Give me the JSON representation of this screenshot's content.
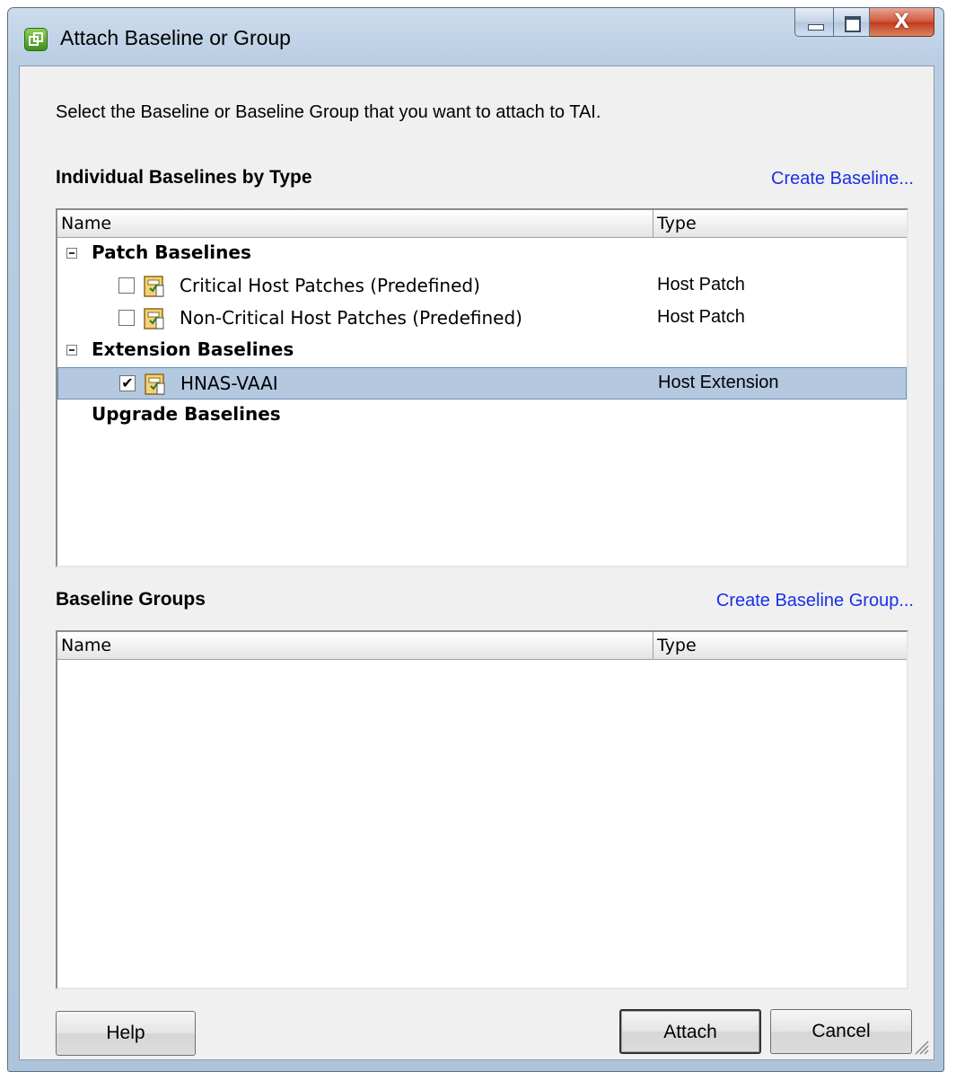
{
  "window": {
    "title": "Attach Baseline or Group",
    "close_glyph": "X"
  },
  "instruction": "Select the Baseline or Baseline Group that you want to attach to TAI.",
  "individual": {
    "heading": "Individual Baselines by Type",
    "create_link": "Create Baseline...",
    "columns": {
      "name": "Name",
      "type": "Type"
    },
    "groups": [
      {
        "label": "Patch Baselines",
        "expanded": true,
        "items": [
          {
            "name": "Critical Host Patches (Predefined)",
            "type": "Host Patch",
            "checked": false
          },
          {
            "name": "Non-Critical Host Patches (Predefined)",
            "type": "Host Patch",
            "checked": false
          }
        ]
      },
      {
        "label": "Extension Baselines",
        "expanded": true,
        "items": [
          {
            "name": "HNAS-VAAI",
            "type": "Host Extension",
            "checked": true,
            "selected": true
          }
        ]
      },
      {
        "label": "Upgrade Baselines",
        "expanded": false,
        "items": []
      }
    ],
    "check_mark": "✔"
  },
  "groups_section": {
    "heading": "Baseline Groups",
    "create_link": "Create Baseline Group...",
    "columns": {
      "name": "Name",
      "type": "Type"
    }
  },
  "buttons": {
    "help": "Help",
    "attach": "Attach",
    "cancel": "Cancel"
  },
  "colors": {
    "selection": "#b4c8e0",
    "link": "#1a30e6"
  }
}
